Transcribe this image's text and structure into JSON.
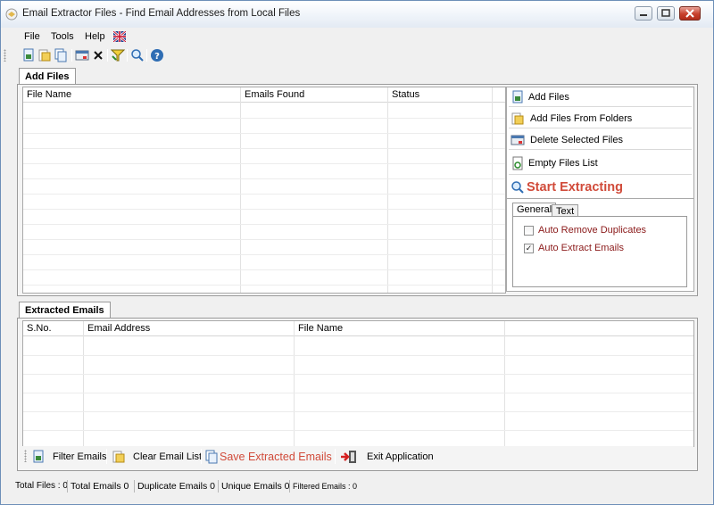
{
  "window": {
    "title": "Email Extractor Files -  Find Email Addresses from Local Files"
  },
  "menu": [
    "File",
    "Tools",
    "Help"
  ],
  "toolbar_icons": [
    "add-files-icon",
    "add-folder-icon",
    "copy-icon",
    "delete-selected-icon",
    "delete-icon",
    "filter-icon",
    "search-icon",
    "help-icon"
  ],
  "add_files": {
    "tab_label": "Add Files",
    "columns": [
      "File Name",
      "Emails Found",
      "Status"
    ]
  },
  "actions": {
    "add_files": "Add Files",
    "add_folders": "Add Files From Folders",
    "delete_selected": "Delete Selected Files",
    "empty_list": "Empty Files List",
    "start": "Start Extracting"
  },
  "options": {
    "tabs": [
      "General",
      "Text"
    ],
    "auto_remove_duplicates": {
      "label": "Auto Remove Duplicates",
      "checked": false
    },
    "auto_extract_emails": {
      "label": "Auto Extract Emails",
      "checked": true
    }
  },
  "extracted": {
    "tab_label": "Extracted Emails",
    "columns": [
      "S.No.",
      "Email Address",
      "File Name"
    ]
  },
  "bottom_toolbar": {
    "filter": "Filter Emails",
    "clear": "Clear Email List",
    "save": "Save Extracted Emails",
    "exit": "Exit Application"
  },
  "status": {
    "total_files": "Total Files : 0",
    "total_emails": "Total Emails  0",
    "duplicate_emails": "Duplicate Emails  0",
    "unique_emails": "Unique Emails  0",
    "filtered_emails": "Filtered Emails :  0"
  },
  "colors": {
    "accent_red": "#d14b3a",
    "option_label": "#8b1a1a"
  }
}
